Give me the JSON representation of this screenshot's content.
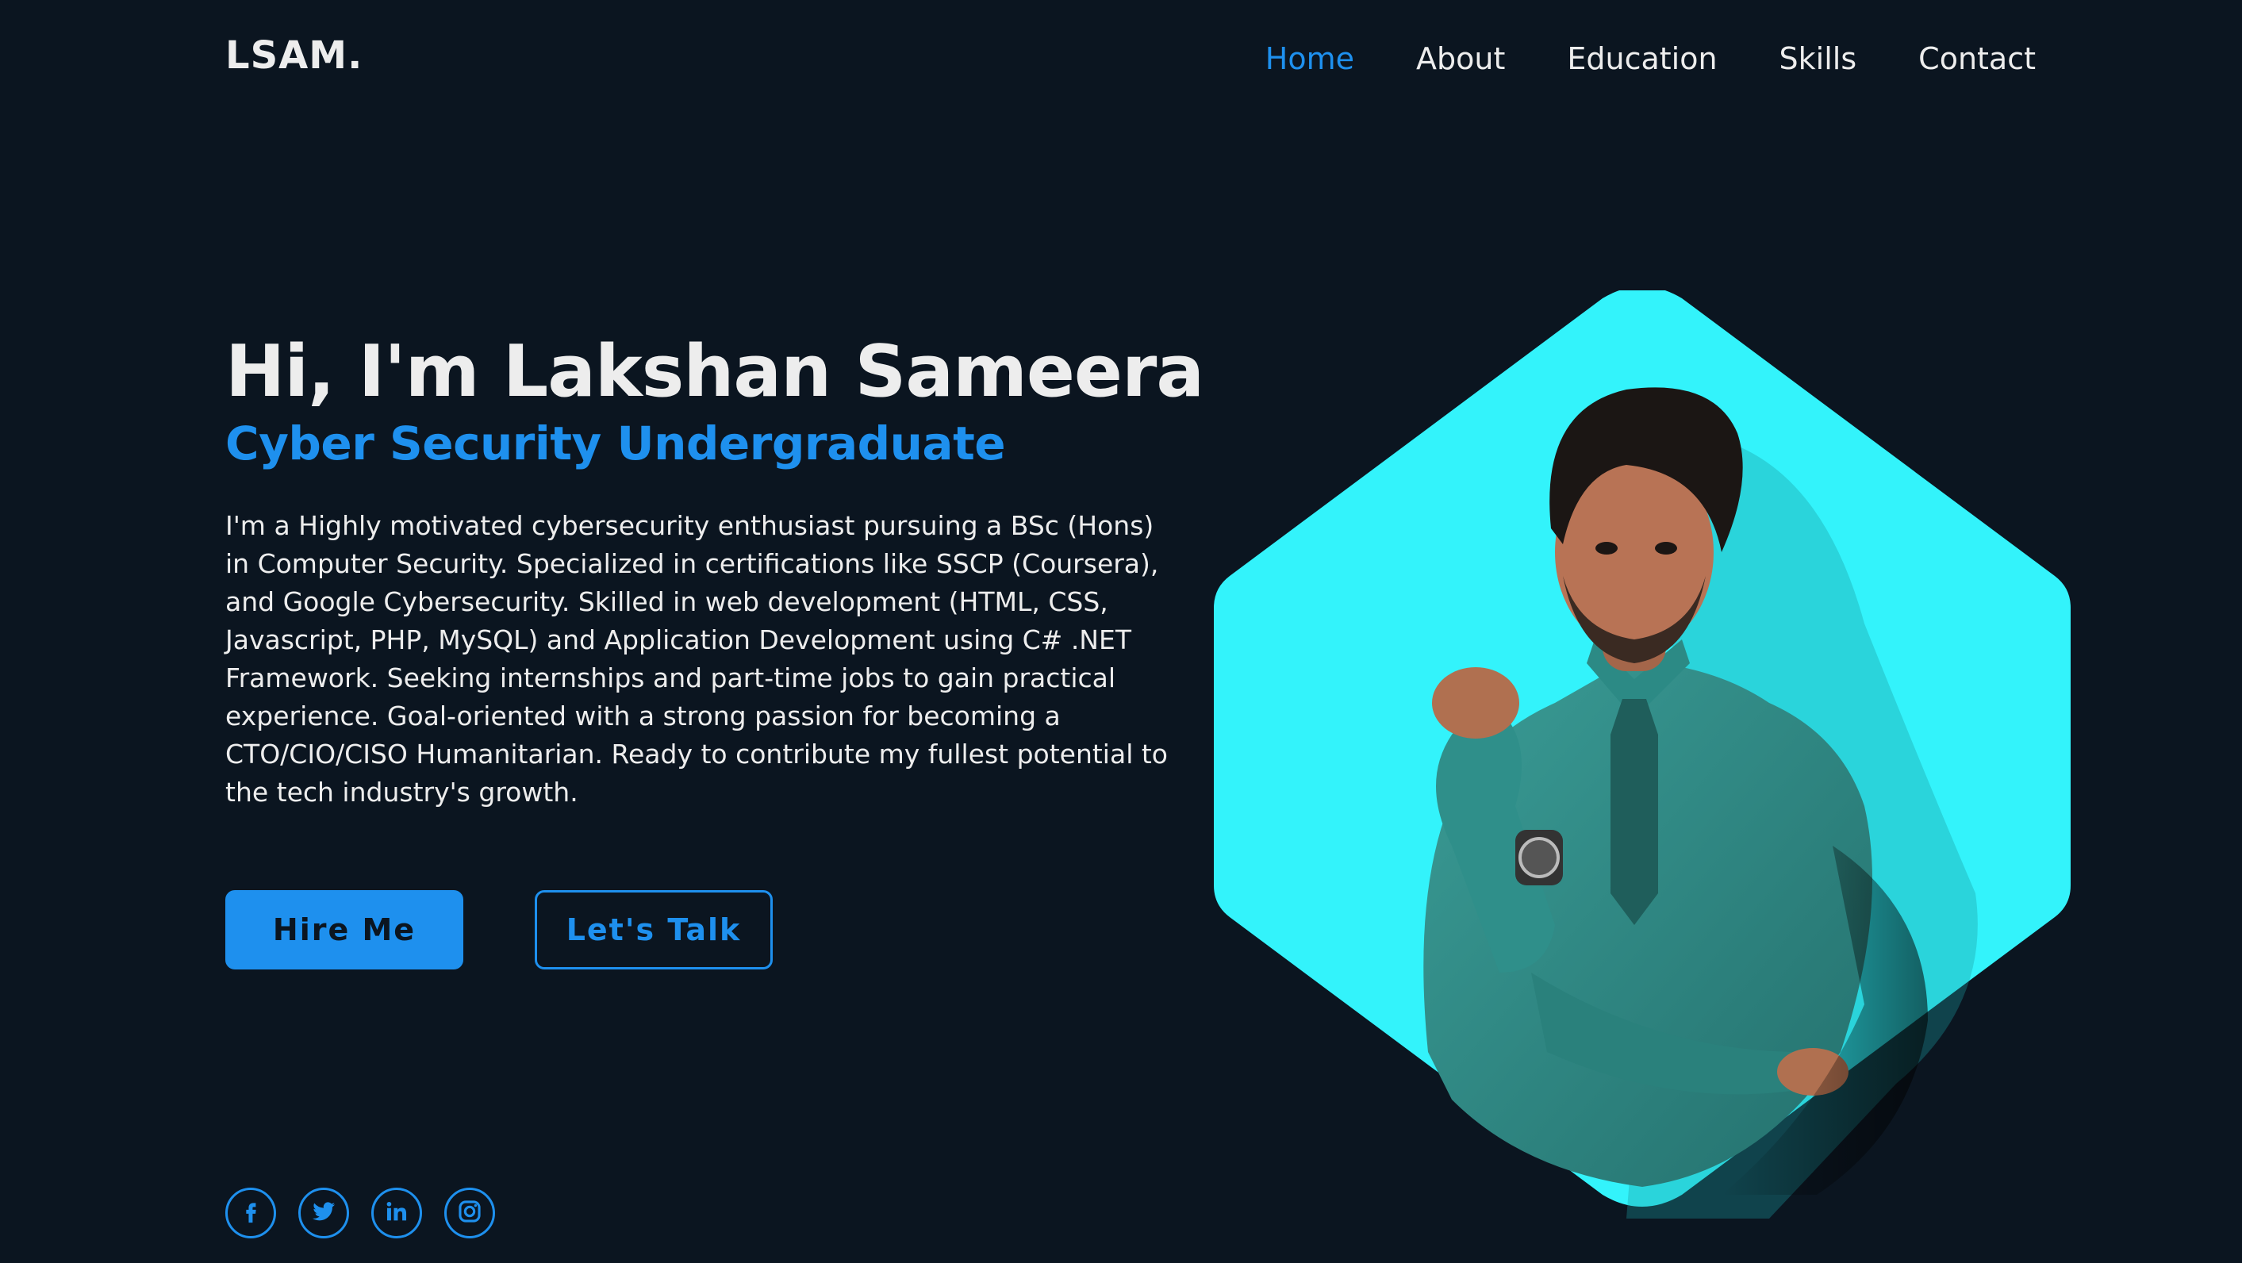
{
  "header": {
    "logo": "LSAM.",
    "nav": [
      "Home",
      "About",
      "Education",
      "Skills",
      "Contact"
    ],
    "active_nav": "Home"
  },
  "hero": {
    "title": "Hi, I'm Lakshan Sameera",
    "subtitle": "Cyber Security Undergraduate",
    "description": "I'm a Highly motivated cybersecurity enthusiast pursuing a BSc (Hons) in Computer Security. Specialized in certifications like SSCP (Coursera), and Google Cybersecurity. Skilled in web development (HTML, CSS, Javascript, PHP, MySQL) and Application Development using C# .NET Framework. Seeking internships and part-time jobs to gain practical experience. Goal-oriented with a strong passion for becoming a CTO/CIO/CISO Humanitarian. Ready to contribute my fullest potential to the tech industry's growth.",
    "buttons": {
      "hire": "Hire Me",
      "talk": "Let's Talk"
    }
  },
  "socials": [
    {
      "name": "facebook-icon"
    },
    {
      "name": "twitter-icon"
    },
    {
      "name": "linkedin-icon"
    },
    {
      "name": "instagram-icon"
    }
  ],
  "colors": {
    "background": "#0b1520",
    "accent": "#1e90ee",
    "hexagon": "#33f3fb",
    "text": "#ededed"
  }
}
